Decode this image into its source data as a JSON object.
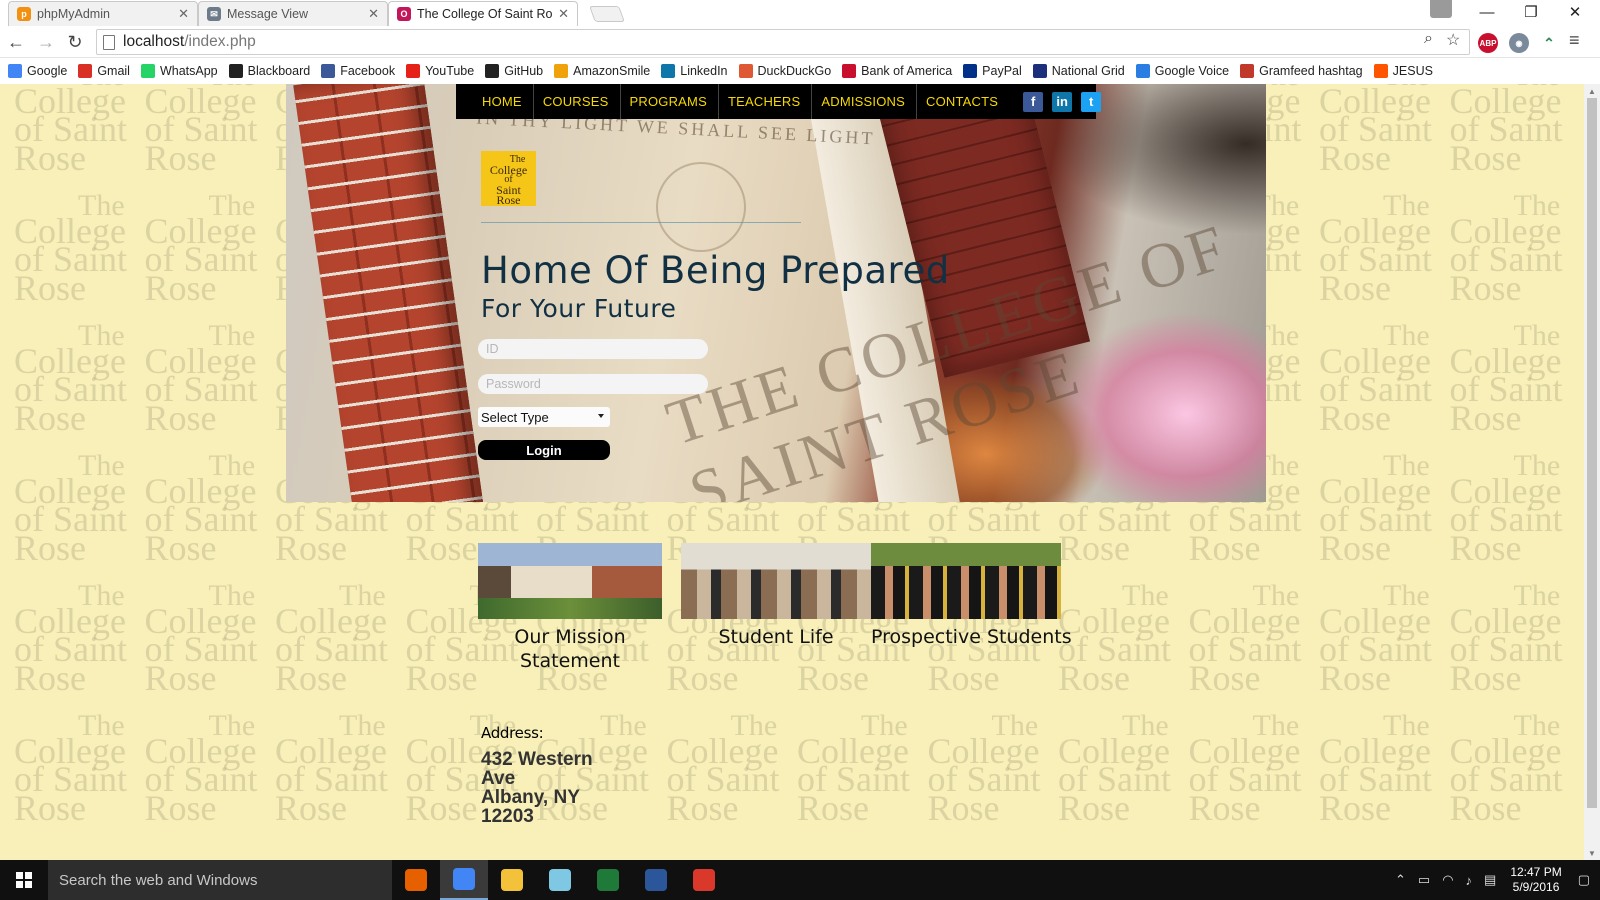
{
  "browser": {
    "tabs": [
      {
        "title": "phpMyAdmin",
        "active": false
      },
      {
        "title": "Message View",
        "active": false
      },
      {
        "title": "The College Of Saint Rose",
        "active": true
      }
    ],
    "url_host": "localhost",
    "url_path": "/index.php",
    "bookmarks": [
      {
        "label": "Google",
        "icon": "google-icon",
        "color": "#4285f4"
      },
      {
        "label": "Gmail",
        "icon": "gmail-icon",
        "color": "#d93025"
      },
      {
        "label": "WhatsApp",
        "icon": "whatsapp-icon",
        "color": "#25d366"
      },
      {
        "label": "Blackboard",
        "icon": "blackboard-icon",
        "color": "#222222"
      },
      {
        "label": "Facebook",
        "icon": "facebook-icon",
        "color": "#3b5998"
      },
      {
        "label": "YouTube",
        "icon": "youtube-icon",
        "color": "#e62117"
      },
      {
        "label": "GitHub",
        "icon": "github-icon",
        "color": "#222222"
      },
      {
        "label": "AmazonSmile",
        "icon": "amazon-icon",
        "color": "#f0a20a"
      },
      {
        "label": "LinkedIn",
        "icon": "linkedin-icon",
        "color": "#0e76a8"
      },
      {
        "label": "DuckDuckGo",
        "icon": "duckduckgo-icon",
        "color": "#de5833"
      },
      {
        "label": "Bank of America",
        "icon": "bofa-icon",
        "color": "#c8102e"
      },
      {
        "label": "PayPal",
        "icon": "paypal-icon",
        "color": "#003087"
      },
      {
        "label": "National Grid",
        "icon": "nationalgrid-icon",
        "color": "#1c2f7a"
      },
      {
        "label": "Google Voice",
        "icon": "googlevoice-icon",
        "color": "#2a7de1"
      },
      {
        "label": "Gramfeed hashtag",
        "icon": "gramfeed-icon",
        "color": "#c0392b"
      },
      {
        "label": "JESUS",
        "icon": "soundcloud-icon",
        "color": "#ff5500"
      }
    ],
    "extensions": {
      "abp": "ABP"
    }
  },
  "site": {
    "nav": [
      "HOME",
      "COURSES",
      "PROGRAMS",
      "TEACHERS",
      "ADMISSIONS",
      "CONTACTS"
    ],
    "social": [
      {
        "icon": "facebook-icon",
        "glyph": "f",
        "color": "#3b5998"
      },
      {
        "icon": "linkedin-icon",
        "glyph": "in",
        "color": "#0e76a8"
      },
      {
        "icon": "twitter-icon",
        "glyph": "t",
        "color": "#1da1f2"
      }
    ],
    "logo_lines": [
      "The",
      "College",
      "of",
      "Saint",
      "Rose"
    ],
    "sign_top": "IN THY LIGHT WE SHALL SEE LIGHT",
    "sign_big": "THE COLLEGE OF SAINT ROSE",
    "title": "Home Of Being Prepared",
    "subtitle": "For Your Future",
    "login": {
      "id_placeholder": "ID",
      "password_placeholder": "Password",
      "select_value": "Select Type",
      "button": "Login"
    },
    "features": [
      {
        "caption": "Our Mission Statement"
      },
      {
        "caption": "Student Life"
      },
      {
        "caption": "Prospective Students"
      }
    ],
    "address_label": "Address:",
    "address_lines": [
      "432 Western",
      "Ave",
      "Albany, NY",
      "12203"
    ],
    "watermark": [
      "The",
      "College",
      "of Saint",
      "Rose"
    ],
    "colors": {
      "nav_text": "#f6d900",
      "page_bg": "#f8f0b8",
      "logo_bg": "#f5c518",
      "title": "#123044"
    }
  },
  "taskbar": {
    "search_placeholder": "Search the web and Windows",
    "apps": [
      {
        "icon": "firefox-icon",
        "color": "#e66000",
        "active": false
      },
      {
        "icon": "chrome-icon",
        "color": "#4285f4",
        "active": true
      },
      {
        "icon": "file-explorer-icon",
        "color": "#f3c13a",
        "active": false
      },
      {
        "icon": "notepad-icon",
        "color": "#7ec8e3",
        "active": false
      },
      {
        "icon": "spreadsheet-icon",
        "color": "#1f7a3a",
        "active": false
      },
      {
        "icon": "word-icon",
        "color": "#2b579a",
        "active": false
      },
      {
        "icon": "recorder-icon",
        "color": "#d9382b",
        "active": false
      }
    ],
    "time": "12:47 PM",
    "date": "5/9/2016"
  }
}
